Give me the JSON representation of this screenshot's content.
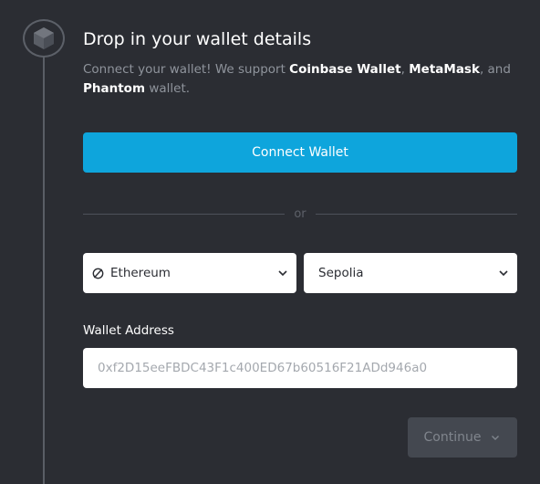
{
  "step": {
    "icon": "cube-icon"
  },
  "header": {
    "title": "Drop in your wallet details",
    "subtitle_prefix": "Connect your wallet! We support ",
    "wallet_1": "Coinbase Wallet",
    "sep_1": ", ",
    "wallet_2": "MetaMask",
    "sep_2": ", and",
    "wallet_3": "Phantom",
    "subtitle_suffix": " wallet."
  },
  "connect": {
    "label": "Connect Wallet"
  },
  "divider": {
    "label": "or"
  },
  "chain_select": {
    "icon": "ethereum-icon",
    "value": "Ethereum"
  },
  "network_select": {
    "value": "Sepolia"
  },
  "address": {
    "label": "Wallet Address",
    "placeholder": "0xf2D15eeFBDC43F1c400ED67b60516F21ADd946a0",
    "value": ""
  },
  "continue": {
    "label": "Continue"
  },
  "colors": {
    "background": "#2b2d33",
    "accent": "#0ea5dc",
    "disabled_button": "#444850",
    "muted_text": "#8f949c"
  }
}
